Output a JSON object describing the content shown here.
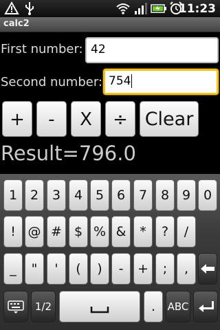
{
  "status_bar": {
    "time": "11:23",
    "icons": [
      "warning-icon",
      "usb-icon",
      "wifi-icon",
      "signal-icon",
      "battery-charging-icon",
      "alarm-icon"
    ]
  },
  "app": {
    "title": "calc2"
  },
  "form": {
    "first_label": "First number:",
    "first_value": "42",
    "second_label": "Second number:",
    "second_value": "754"
  },
  "ops": {
    "add": "+",
    "subtract": "-",
    "multiply": "X",
    "divide": "÷",
    "clear": "Clear"
  },
  "result": "Result=796.0",
  "keyboard": {
    "row1": [
      "1",
      "2",
      "3",
      "4",
      "5",
      "6",
      "7",
      "8",
      "9",
      "0"
    ],
    "row2": [
      "!",
      "@",
      "#",
      "$",
      "%",
      "&",
      "*",
      "?",
      "/"
    ],
    "row3": [
      "_",
      "\"",
      "'",
      "(",
      ")",
      "-",
      "+",
      ";",
      ","
    ],
    "alt_label": "1/2",
    "period_label": ".",
    "abc_label": "ABC"
  }
}
